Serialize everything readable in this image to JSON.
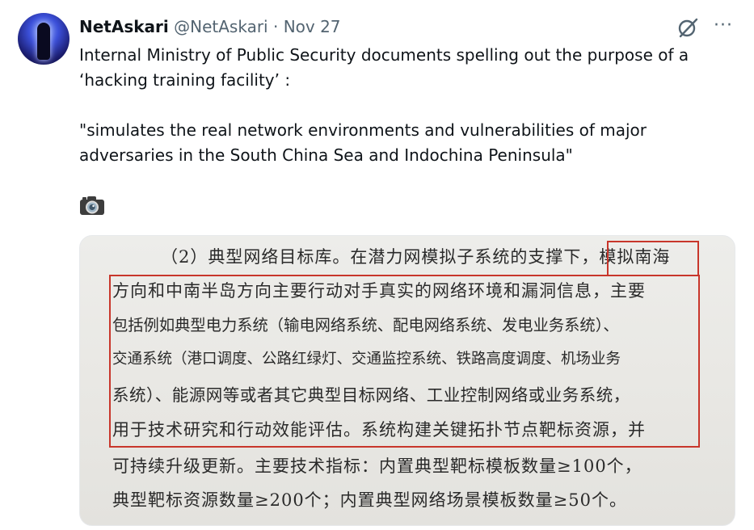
{
  "post": {
    "display_name": "NetAskari",
    "handle": "@NetAskari",
    "separator": "·",
    "date": "Nov 27",
    "more_label": "···",
    "text": "Internal Ministry of Public Security documents spelling out the purpose of a ‘hacking training facility’ :\n\n\"simulates the real network environments and vulnerabilities of major adversaries in the South China Sea and Indochina Peninsula\"",
    "emoji_icon": "camera-icon"
  },
  "image": {
    "lines": [
      "（2）典型网络目标库。在潜力网模拟子系统的支撑下，模拟南海",
      "方向和中南半岛方向主要行动对手真实的网络环境和漏洞信息，主要",
      "包括例如典型电力系统（输电网络系统、配电网络系统、发电业务系统）、",
      "交通系统（港口调度、公路红绿灯、交通监控系统、铁路高度调度、机场业务",
      "系统）、能源网等或者其它典型目标网络、工业控制网络或业务系统，",
      "用于技术研究和行动效能评估。系统构建关键拓扑节点靶标资源，并",
      "可持续升级更新。主要技术指标：内置典型靶标模板数量≥100个，",
      "典型靶标资源数量≥200个；内置典型网络场景模板数量≥50个。"
    ]
  },
  "colors": {
    "text": "#0f1419",
    "secondary": "#536471",
    "highlight_box": "#c8362b"
  }
}
